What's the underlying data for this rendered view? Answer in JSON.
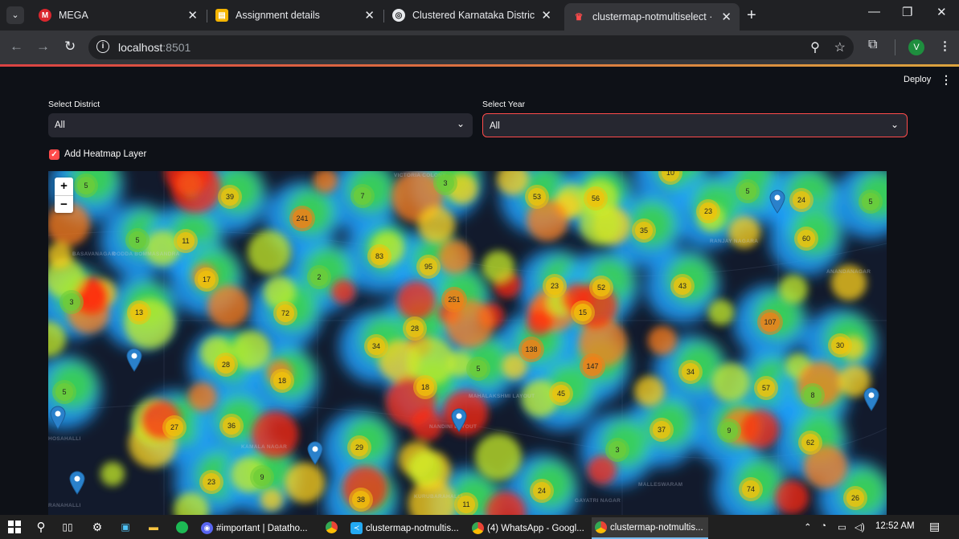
{
  "browser": {
    "tabs": [
      {
        "title": "MEGA",
        "icon": "mega-icon",
        "color": "#d9272e",
        "active": false
      },
      {
        "title": "Assignment details",
        "icon": "classroom-icon",
        "color": "#f4b400",
        "active": false
      },
      {
        "title": "Clustered Karnataka District Ma",
        "icon": "chatgpt-icon",
        "color": "#e8eaed",
        "active": false
      },
      {
        "title": "clustermap-notmultiselect · Stre",
        "icon": "streamlit-icon",
        "color": "#ff4b4b",
        "active": true
      }
    ],
    "url_host": "localhost",
    "url_port": ":8501",
    "profile_initial": "V"
  },
  "app": {
    "deploy_label": "Deploy",
    "district_label": "Select District",
    "district_value": "All",
    "year_label": "Select Year",
    "year_value": "All",
    "heatmap_label": "Add Heatmap Layer",
    "heatmap_checked": true,
    "accent_color": "#ff4b4b"
  },
  "map": {
    "zoom_in": "+",
    "zoom_out": "−",
    "area_labels": [
      "VICTORIA COLONY",
      "RANJAY NAGARA",
      "ANANDANAGAR",
      "BASAVANAGAR",
      "NANDINI LAYOUT",
      "MAHALAKSHMI LAYOUT",
      "GAYATRI NAGAR",
      "MALLESWARAM",
      "DODDA BOMMASANDRA",
      "RANAHALLI",
      "KURUBARAHALLI",
      "HOSAHALLI",
      "KAMALA NAGAR"
    ],
    "clusters": [
      {
        "label": "5",
        "tier": "green"
      },
      {
        "label": "39",
        "tier": "yellow"
      },
      {
        "label": "7",
        "tier": "green"
      },
      {
        "label": "3",
        "tier": "green"
      },
      {
        "label": "53",
        "tier": "yellow"
      },
      {
        "label": "56",
        "tier": "yellow"
      },
      {
        "label": "10",
        "tier": "yellow"
      },
      {
        "label": "5",
        "tier": "green"
      },
      {
        "label": "24",
        "tier": "yellow"
      },
      {
        "label": "5",
        "tier": "green"
      },
      {
        "label": "241",
        "tier": "orange"
      },
      {
        "label": "23",
        "tier": "yellow"
      },
      {
        "label": "5",
        "tier": "green"
      },
      {
        "label": "11",
        "tier": "yellow"
      },
      {
        "label": "35",
        "tier": "yellow"
      },
      {
        "label": "60",
        "tier": "yellow"
      },
      {
        "label": "83",
        "tier": "yellow"
      },
      {
        "label": "95",
        "tier": "yellow"
      },
      {
        "label": "17",
        "tier": "yellow"
      },
      {
        "label": "2",
        "tier": "green"
      },
      {
        "label": "23",
        "tier": "yellow"
      },
      {
        "label": "52",
        "tier": "yellow"
      },
      {
        "label": "43",
        "tier": "yellow"
      },
      {
        "label": "3",
        "tier": "green"
      },
      {
        "label": "13",
        "tier": "yellow"
      },
      {
        "label": "72",
        "tier": "yellow"
      },
      {
        "label": "251",
        "tier": "orange"
      },
      {
        "label": "15",
        "tier": "yellow"
      },
      {
        "label": "107",
        "tier": "orange"
      },
      {
        "label": "28",
        "tier": "yellow"
      },
      {
        "label": "34",
        "tier": "yellow"
      },
      {
        "label": "138",
        "tier": "orange"
      },
      {
        "label": "30",
        "tier": "yellow"
      },
      {
        "label": "28",
        "tier": "yellow"
      },
      {
        "label": "5",
        "tier": "green"
      },
      {
        "label": "147",
        "tier": "orange"
      },
      {
        "label": "34",
        "tier": "yellow"
      },
      {
        "label": "18",
        "tier": "yellow"
      },
      {
        "label": "5",
        "tier": "green"
      },
      {
        "label": "18",
        "tier": "yellow"
      },
      {
        "label": "45",
        "tier": "yellow"
      },
      {
        "label": "57",
        "tier": "yellow"
      },
      {
        "label": "8",
        "tier": "green"
      },
      {
        "label": "27",
        "tier": "yellow"
      },
      {
        "label": "36",
        "tier": "yellow"
      },
      {
        "label": "37",
        "tier": "yellow"
      },
      {
        "label": "9",
        "tier": "green"
      },
      {
        "label": "62",
        "tier": "yellow"
      },
      {
        "label": "29",
        "tier": "yellow"
      },
      {
        "label": "3",
        "tier": "green"
      },
      {
        "label": "23",
        "tier": "yellow"
      },
      {
        "label": "9",
        "tier": "green"
      },
      {
        "label": "24",
        "tier": "yellow"
      },
      {
        "label": "74",
        "tier": "yellow"
      },
      {
        "label": "38",
        "tier": "yellow"
      },
      {
        "label": "11",
        "tier": "yellow"
      },
      {
        "label": "26",
        "tier": "yellow"
      }
    ],
    "pin_color": "#2a81cb"
  },
  "taskbar": {
    "apps": [
      {
        "label": "#important | Datatho...",
        "icon": "discord-icon",
        "color": "#5865f2"
      },
      {
        "label": "clustermap-notmultis...",
        "icon": "vscode-icon",
        "color": "#23a9f2"
      },
      {
        "label": "(4) WhatsApp - Googl...",
        "icon": "chrome-icon",
        "color": "#34a853"
      },
      {
        "label": "clustermap-notmultis...",
        "icon": "chrome-icon",
        "color": "#fbbc04"
      }
    ],
    "time": "12:52 AM"
  }
}
